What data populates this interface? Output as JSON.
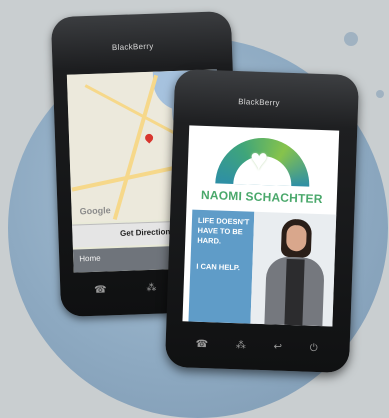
{
  "phone_back": {
    "brand": "BlackBerry",
    "map_label": "Google",
    "action_button": "Get Directions",
    "home_label": "Home"
  },
  "phone_front": {
    "brand": "BlackBerry",
    "ad_title": "NAOMI SCHACHTER",
    "tagline": "LIFE DOESN'T HAVE TO BE HARD.",
    "cta": "I CAN HELP."
  }
}
